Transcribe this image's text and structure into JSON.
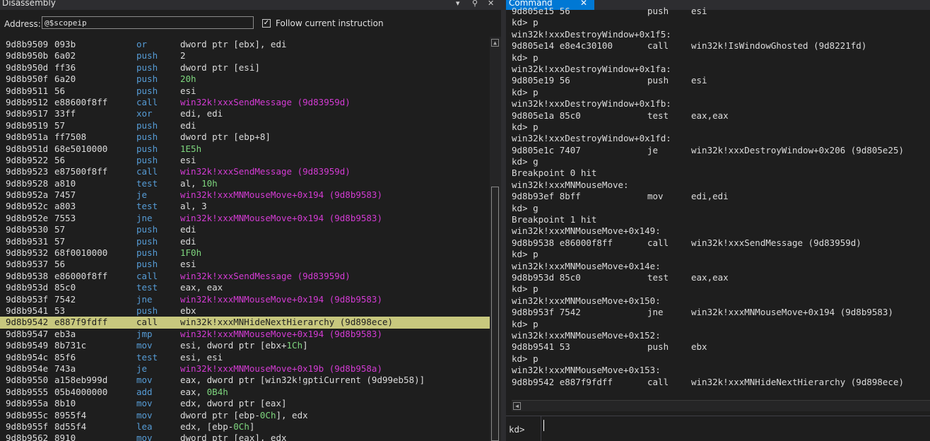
{
  "disassembly": {
    "title": "Disassembly",
    "address_label": "Address:",
    "address_value": "@$scopeip",
    "follow_label": "Follow current instruction",
    "follow_checked": true,
    "rows": [
      {
        "addr": "9d8b9509",
        "bytes": "093b",
        "mn": "or",
        "op": [
          {
            "t": "dword ptr [ebx], edi"
          }
        ]
      },
      {
        "addr": "9d8b950b",
        "bytes": "6a02",
        "mn": "push",
        "op": [
          {
            "t": "2"
          }
        ]
      },
      {
        "addr": "9d8b950d",
        "bytes": "ff36",
        "mn": "push",
        "op": [
          {
            "t": "dword ptr [esi]"
          }
        ]
      },
      {
        "addr": "9d8b950f",
        "bytes": "6a20",
        "mn": "push",
        "op": [
          {
            "t": "20h",
            "c": "num"
          }
        ]
      },
      {
        "addr": "9d8b9511",
        "bytes": "56",
        "mn": "push",
        "op": [
          {
            "t": "esi"
          }
        ]
      },
      {
        "addr": "9d8b9512",
        "bytes": "e88600f8ff",
        "mn": "call",
        "op": [
          {
            "t": "win32k!xxxSendMessage (9d83959d)",
            "c": "mag"
          }
        ]
      },
      {
        "addr": "9d8b9517",
        "bytes": "33ff",
        "mn": "xor",
        "op": [
          {
            "t": "edi, edi"
          }
        ]
      },
      {
        "addr": "9d8b9519",
        "bytes": "57",
        "mn": "push",
        "op": [
          {
            "t": "edi"
          }
        ]
      },
      {
        "addr": "9d8b951a",
        "bytes": "ff7508",
        "mn": "push",
        "op": [
          {
            "t": "dword ptr [ebp+8]"
          }
        ]
      },
      {
        "addr": "9d8b951d",
        "bytes": "68e5010000",
        "mn": "push",
        "op": [
          {
            "t": "1E5h",
            "c": "num"
          }
        ]
      },
      {
        "addr": "9d8b9522",
        "bytes": "56",
        "mn": "push",
        "op": [
          {
            "t": "esi"
          }
        ]
      },
      {
        "addr": "9d8b9523",
        "bytes": "e87500f8ff",
        "mn": "call",
        "op": [
          {
            "t": "win32k!xxxSendMessage (9d83959d)",
            "c": "mag"
          }
        ]
      },
      {
        "addr": "9d8b9528",
        "bytes": "a810",
        "mn": "test",
        "op": [
          {
            "t": "al, "
          },
          {
            "t": "10h",
            "c": "num"
          }
        ]
      },
      {
        "addr": "9d8b952a",
        "bytes": "7457",
        "mn": "je",
        "op": [
          {
            "t": "win32k!xxxMNMouseMove+0x194 (9d8b9583)",
            "c": "mag"
          }
        ]
      },
      {
        "addr": "9d8b952c",
        "bytes": "a803",
        "mn": "test",
        "op": [
          {
            "t": "al, 3"
          }
        ]
      },
      {
        "addr": "9d8b952e",
        "bytes": "7553",
        "mn": "jne",
        "op": [
          {
            "t": "win32k!xxxMNMouseMove+0x194 (9d8b9583)",
            "c": "mag"
          }
        ]
      },
      {
        "addr": "9d8b9530",
        "bytes": "57",
        "mn": "push",
        "op": [
          {
            "t": "edi"
          }
        ]
      },
      {
        "addr": "9d8b9531",
        "bytes": "57",
        "mn": "push",
        "op": [
          {
            "t": "edi"
          }
        ]
      },
      {
        "addr": "9d8b9532",
        "bytes": "68f0010000",
        "mn": "push",
        "op": [
          {
            "t": "1F0h",
            "c": "num"
          }
        ]
      },
      {
        "addr": "9d8b9537",
        "bytes": "56",
        "mn": "push",
        "op": [
          {
            "t": "esi"
          }
        ]
      },
      {
        "addr": "9d8b9538",
        "bytes": "e86000f8ff",
        "mn": "call",
        "op": [
          {
            "t": "win32k!xxxSendMessage (9d83959d)",
            "c": "mag"
          }
        ]
      },
      {
        "addr": "9d8b953d",
        "bytes": "85c0",
        "mn": "test",
        "op": [
          {
            "t": "eax, eax"
          }
        ]
      },
      {
        "addr": "9d8b953f",
        "bytes": "7542",
        "mn": "jne",
        "op": [
          {
            "t": "win32k!xxxMNMouseMove+0x194 (9d8b9583)",
            "c": "mag"
          }
        ]
      },
      {
        "addr": "9d8b9541",
        "bytes": "53",
        "mn": "push",
        "op": [
          {
            "t": "ebx"
          }
        ]
      },
      {
        "addr": "9d8b9542",
        "bytes": "e887f9fdff",
        "mn": "call",
        "op": [
          {
            "t": "win32k!xxxMNHideNextHierarchy (9d898ece)"
          }
        ],
        "current": true
      },
      {
        "addr": "9d8b9547",
        "bytes": "eb3a",
        "mn": "jmp",
        "op": [
          {
            "t": "win32k!xxxMNMouseMove+0x194 (9d8b9583)",
            "c": "mag"
          }
        ]
      },
      {
        "addr": "9d8b9549",
        "bytes": "8b731c",
        "mn": "mov",
        "op": [
          {
            "t": "esi, dword ptr [ebx+"
          },
          {
            "t": "1Ch",
            "c": "num"
          },
          {
            "t": "]"
          }
        ]
      },
      {
        "addr": "9d8b954c",
        "bytes": "85f6",
        "mn": "test",
        "op": [
          {
            "t": "esi, esi"
          }
        ]
      },
      {
        "addr": "9d8b954e",
        "bytes": "743a",
        "mn": "je",
        "op": [
          {
            "t": "win32k!xxxMNMouseMove+0x19b (9d8b958a)",
            "c": "mag"
          }
        ]
      },
      {
        "addr": "9d8b9550",
        "bytes": "a158eb999d",
        "mn": "mov",
        "op": [
          {
            "t": "eax, dword ptr [win32k!gptiCurrent (9d99eb58)]"
          }
        ]
      },
      {
        "addr": "9d8b9555",
        "bytes": "05b4000000",
        "mn": "add",
        "op": [
          {
            "t": "eax, "
          },
          {
            "t": "0B4h",
            "c": "num"
          }
        ]
      },
      {
        "addr": "9d8b955a",
        "bytes": "8b10",
        "mn": "mov",
        "op": [
          {
            "t": "edx, dword ptr [eax]"
          }
        ]
      },
      {
        "addr": "9d8b955c",
        "bytes": "8955f4",
        "mn": "mov",
        "op": [
          {
            "t": "dword ptr [ebp-"
          },
          {
            "t": "0Ch",
            "c": "num"
          },
          {
            "t": "], edx"
          }
        ]
      },
      {
        "addr": "9d8b955f",
        "bytes": "8d55f4",
        "mn": "lea",
        "op": [
          {
            "t": "edx, [ebp-"
          },
          {
            "t": "0Ch",
            "c": "num"
          },
          {
            "t": "]"
          }
        ]
      },
      {
        "addr": "9d8b9562",
        "bytes": "8910",
        "mn": "mov",
        "op": [
          {
            "t": "dword ptr [eax], edx"
          }
        ]
      }
    ]
  },
  "command": {
    "title": "Command",
    "lines": [
      {
        "addr": "9d805e15 56",
        "mn": "push",
        "op": "esi"
      },
      {
        "text": "kd> p"
      },
      {
        "text": "win32k!xxxDestroyWindow+0x1f5:"
      },
      {
        "addr": "9d805e14 e8e4c30100",
        "mn": "call",
        "op": "win32k!IsWindowGhosted (9d8221fd)"
      },
      {
        "text": "kd> p"
      },
      {
        "text": "win32k!xxxDestroyWindow+0x1fa:"
      },
      {
        "addr": "9d805e19 56",
        "mn": "push",
        "op": "esi"
      },
      {
        "text": "kd> p"
      },
      {
        "text": "win32k!xxxDestroyWindow+0x1fb:"
      },
      {
        "addr": "9d805e1a 85c0",
        "mn": "test",
        "op": "eax,eax"
      },
      {
        "text": "kd> p"
      },
      {
        "text": "win32k!xxxDestroyWindow+0x1fd:"
      },
      {
        "addr": "9d805e1c 7407",
        "mn": "je",
        "op": "win32k!xxxDestroyWindow+0x206 (9d805e25)"
      },
      {
        "text": "kd> g"
      },
      {
        "text": "Breakpoint 0 hit"
      },
      {
        "text": "win32k!xxxMNMouseMove:"
      },
      {
        "addr": "9d8b93ef 8bff",
        "mn": "mov",
        "op": "edi,edi"
      },
      {
        "text": "kd> g"
      },
      {
        "text": "Breakpoint 1 hit"
      },
      {
        "text": "win32k!xxxMNMouseMove+0x149:"
      },
      {
        "addr": "9d8b9538 e86000f8ff",
        "mn": "call",
        "op": "win32k!xxxSendMessage (9d83959d)"
      },
      {
        "text": "kd> p"
      },
      {
        "text": "win32k!xxxMNMouseMove+0x14e:"
      },
      {
        "addr": "9d8b953d 85c0",
        "mn": "test",
        "op": "eax,eax"
      },
      {
        "text": "kd> p"
      },
      {
        "text": "win32k!xxxMNMouseMove+0x150:"
      },
      {
        "addr": "9d8b953f 7542",
        "mn": "jne",
        "op": "win32k!xxxMNMouseMove+0x194 (9d8b9583)"
      },
      {
        "text": "kd> p"
      },
      {
        "text": "win32k!xxxMNMouseMove+0x152:"
      },
      {
        "addr": "9d8b9541 53",
        "mn": "push",
        "op": "ebx"
      },
      {
        "text": "kd> p"
      },
      {
        "text": "win32k!xxxMNMouseMove+0x153:"
      },
      {
        "addr": "9d8b9542 e887f9fdff",
        "mn": "call",
        "op": "win32k!xxxMNHideNextHierarchy (9d898ece)"
      }
    ],
    "prompt": "kd>",
    "input_value": ""
  }
}
